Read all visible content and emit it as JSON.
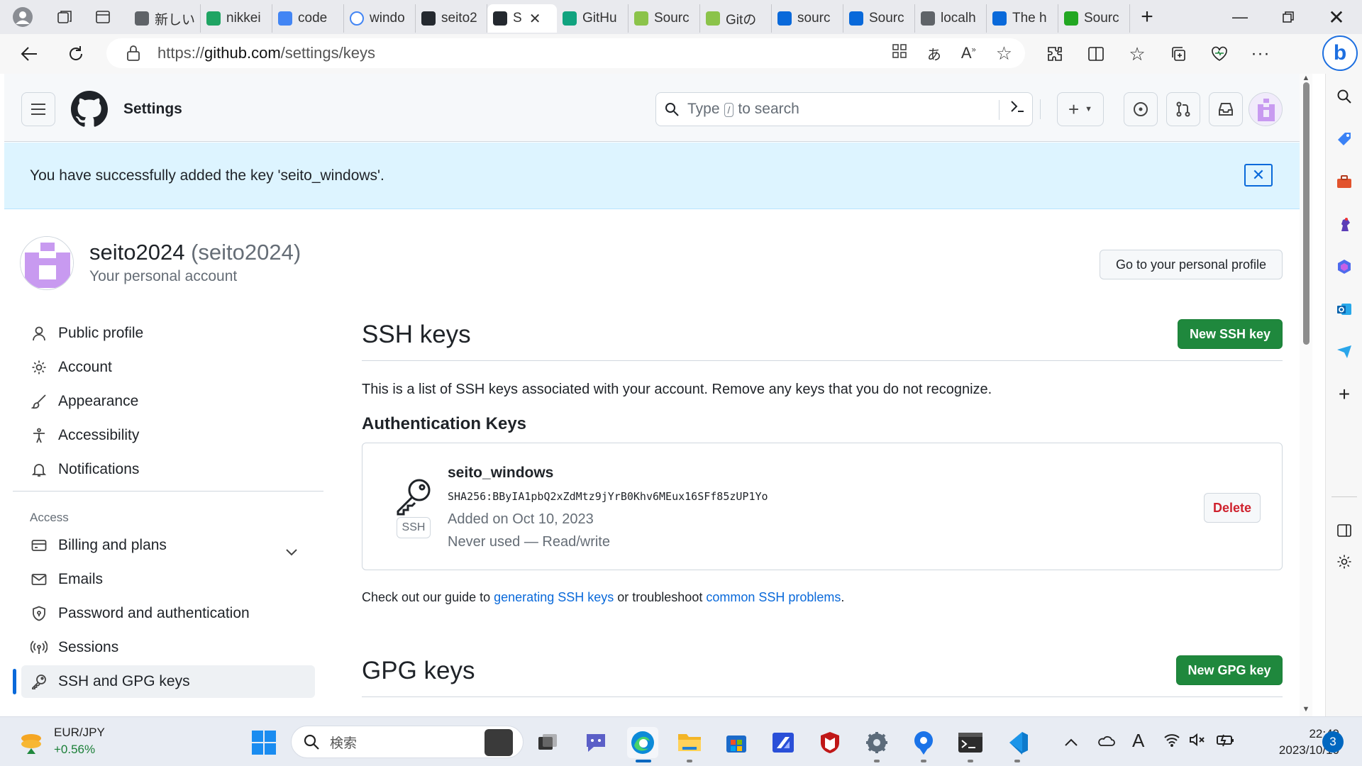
{
  "browser": {
    "tabs": [
      {
        "label": "新しい",
        "fav": "tab-icon",
        "color": "#5f6368"
      },
      {
        "label": "nikkei",
        "fav": "google-drive-icon",
        "color": "#1fa463"
      },
      {
        "label": "code",
        "fav": "google-docs-icon",
        "color": "#4285f4"
      },
      {
        "label": "windo",
        "fav": "google-icon",
        "color": "#ffffff"
      },
      {
        "label": "seito2",
        "fav": "github-icon",
        "color": "#24292f"
      },
      {
        "label": "S",
        "fav": "github-icon",
        "color": "#24292f"
      },
      {
        "label": "GitHu",
        "fav": "chatgpt-icon",
        "color": "#10a37f"
      },
      {
        "label": "Sourc",
        "fav": "sourcetree-icon",
        "color": "#8bc34a"
      },
      {
        "label": "Gitの",
        "fav": "sourcetree-icon",
        "color": "#8bc34a"
      },
      {
        "label": "sourc",
        "fav": "search-icon",
        "color": "#0969da"
      },
      {
        "label": "Sourc",
        "fav": "maps-pin-icon",
        "color": "#0969da"
      },
      {
        "label": "localh",
        "fav": "document-icon",
        "color": "#5f6368"
      },
      {
        "label": "The h",
        "fav": "search-icon",
        "color": "#0969da"
      },
      {
        "label": "Sourc",
        "fav": "sourcetree-icon",
        "color": "#22a722"
      }
    ],
    "url_prefix": "https://",
    "url_host": "github.com",
    "url_path": "/settings/keys"
  },
  "gh": {
    "title": "Settings",
    "search_pre": "Type",
    "search_key": "/",
    "search_post": "to search",
    "flash": "You have successfully added the key 'seito_windows'.",
    "account_name": "seito2024",
    "account_login": "(seito2024)",
    "account_sub": "Your personal account",
    "profile_button": "Go to your personal profile",
    "nav": [
      {
        "label": "Public profile",
        "icon": "person-icon"
      },
      {
        "label": "Account",
        "icon": "gear-icon"
      },
      {
        "label": "Appearance",
        "icon": "paintbrush-icon"
      },
      {
        "label": "Accessibility",
        "icon": "accessibility-icon"
      },
      {
        "label": "Notifications",
        "icon": "bell-icon"
      }
    ],
    "access_heading": "Access",
    "access_nav": [
      {
        "label": "Billing and plans",
        "icon": "credit-card-icon"
      },
      {
        "label": "Emails",
        "icon": "mail-icon"
      },
      {
        "label": "Password and authentication",
        "icon": "shield-lock-icon"
      },
      {
        "label": "Sessions",
        "icon": "broadcast-icon"
      },
      {
        "label": "SSH and GPG keys",
        "icon": "key-icon"
      }
    ],
    "ssh_heading": "SSH keys",
    "new_ssh": "New SSH key",
    "ssh_desc": "This is a list of SSH keys associated with your account. Remove any keys that you do not recognize.",
    "auth_keys_heading": "Authentication Keys",
    "key": {
      "title": "seito_windows",
      "fingerprint": "SHA256:BByIA1pbQ2xZdMtz9jYrB0Khv6MEux16SFf85zUP1Yo",
      "added": "Added on Oct 10, 2023",
      "usage": "Never used — Read/write",
      "badge": "SSH",
      "delete": "Delete"
    },
    "guide_pre": "Check out our guide to",
    "guide_link1": "generating SSH keys",
    "guide_mid": "or troubleshoot",
    "guide_link2": "common SSH problems",
    "guide_post": ".",
    "gpg_heading": "GPG keys",
    "new_gpg": "New GPG key"
  },
  "taskbar": {
    "widget_title": "EUR/JPY",
    "widget_value": "+0.56%",
    "search_placeholder": "検索",
    "time": "22:49",
    "date": "2023/10/10",
    "notifications": "3"
  },
  "colors": {
    "accent": "#0969da",
    "green": "#1f883d",
    "danger": "#cf222e",
    "flash_bg": "#ddf4ff"
  }
}
